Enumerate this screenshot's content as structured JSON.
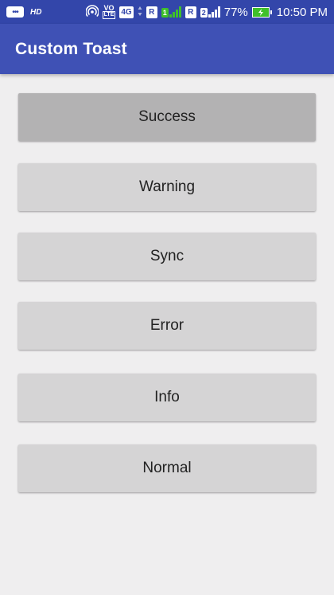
{
  "status_bar": {
    "chat_icon_text": "•••",
    "hd_label": "HD",
    "vo_label": "VO",
    "lte_label": "LTE",
    "network_label": "4G",
    "sim1_label": "R",
    "sim2_badge": "1",
    "sim2_label": "R",
    "sim2_badge2": "2",
    "battery_percent": "77%",
    "time": "10:50 PM"
  },
  "app_bar": {
    "title": "Custom Toast"
  },
  "buttons": {
    "success": "Success",
    "warning": "Warning",
    "sync": "Sync",
    "error": "Error",
    "info": "Info",
    "normal": "Normal"
  },
  "colors": {
    "status_bar": "#3346aa",
    "app_bar": "#3f51b5",
    "background": "#efeeef",
    "button": "#d5d4d5",
    "button_pressed": "#b3b2b3",
    "battery": "#3fc02a"
  }
}
